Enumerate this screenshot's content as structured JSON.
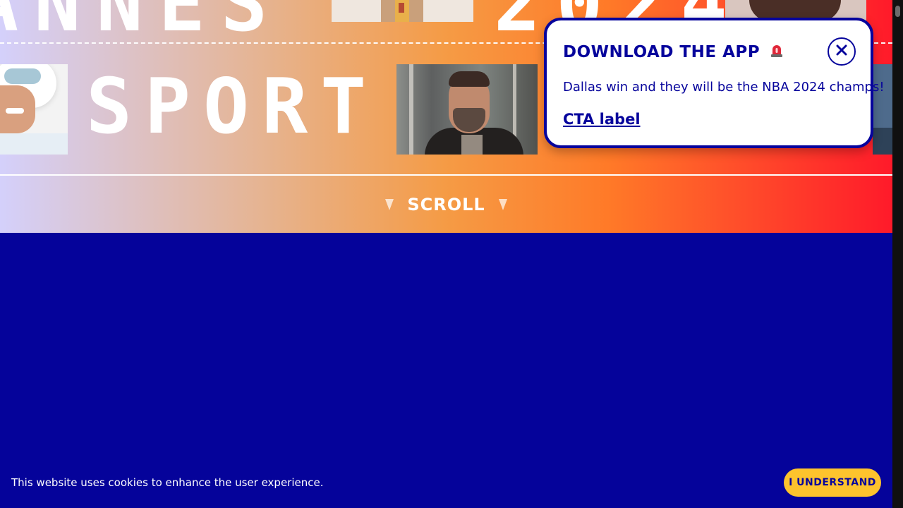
{
  "hero": {
    "top_left_word": "ANNES",
    "top_right_word": "2024",
    "main_word": "SPORT",
    "scroll_label": "SCROLL"
  },
  "popup": {
    "title": "DOWNLOAD THE APP",
    "title_icon": "siren-icon",
    "close_icon": "close-icon",
    "body": "Dallas win and they will be the NBA 2024 champs!",
    "cta": "CTA label"
  },
  "cookie": {
    "text": "This website uses cookies to enhance the user experience.",
    "button": "I UNDERSTAND"
  },
  "colors": {
    "brand_blue": "#06049c",
    "page_background": "#05039a",
    "cookie_button": "#fdc32d",
    "gradient_start": "#d4d0fb",
    "gradient_mid": "#f59b45",
    "gradient_end": "#ff1a2a"
  }
}
